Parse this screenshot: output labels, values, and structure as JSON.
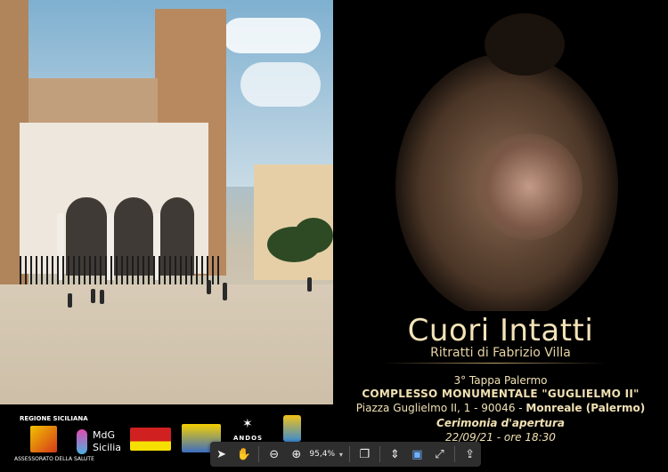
{
  "poster": {
    "title": "Cuori Intatti",
    "subtitle": "Ritratti di Fabrizio Villa",
    "stage": "3° Tappa Palermo",
    "venue": "COMPLESSO MONUMENTALE \"GUGLIELMO II\"",
    "address_prefix": "Piazza Guglielmo II, 1 - 90046 - ",
    "address_city": "Monreale (Palermo)",
    "ceremony": "Cerimonia d'apertura",
    "datetime": "22/09/21 - ore 18:30"
  },
  "sponsors": {
    "region_top": "REGIONE SICILIANA",
    "region_bottom": "ASSESSORATO DELLA SALUTE",
    "mdg": "MdG",
    "mdg2": "Sicilia",
    "andos": "ANDOS"
  },
  "toolbar": {
    "zoom_value": "95,4%",
    "tools": [
      "select-arrow",
      "hand",
      "zoom-out",
      "zoom-in",
      "zoom-dropdown",
      "page-view",
      "fit-page",
      "fit-width",
      "fullscreen",
      "share"
    ]
  }
}
